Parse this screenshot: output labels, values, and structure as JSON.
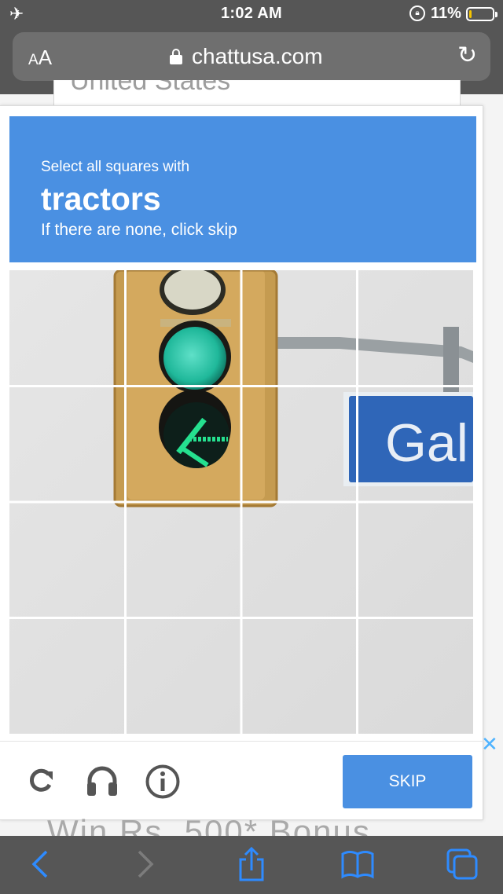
{
  "status_bar": {
    "time": "1:02 AM",
    "battery_percent": "11%",
    "battery_level": 0.11
  },
  "address_bar": {
    "text_size_label": "AA",
    "host": "chattusa.com"
  },
  "background_page": {
    "top_text": "United States",
    "bottom_text": "Win Rs. 500* Bonus."
  },
  "captcha": {
    "instruction": "Select all squares with",
    "target": "tractors",
    "hint": "If there are none, click skip",
    "sign_text": "Gal",
    "skip_label": "SKIP",
    "grid": {
      "rows": 4,
      "cols": 4
    }
  },
  "colors": {
    "accent": "#4a90e2",
    "chrome": "#565656",
    "ad_close": "#4fb3ff",
    "toolbar_icon": "#2e8bff"
  },
  "icons": {
    "airplane": "airplane-icon",
    "rotation_lock": "rotation-lock-icon",
    "reload": "reload-icon",
    "audio": "headphones-icon",
    "info": "info-icon",
    "back": "back-chevron-icon",
    "forward": "forward-chevron-icon",
    "share": "share-icon",
    "bookmarks": "book-icon",
    "tabs": "tabs-icon"
  }
}
